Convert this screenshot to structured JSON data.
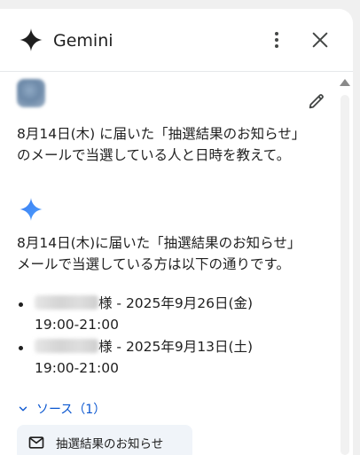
{
  "header": {
    "title": "Gemini",
    "logo_icon": "gemini-sparkle-icon",
    "more_icon": "more-vert-icon",
    "close_icon": "close-icon"
  },
  "prompt": {
    "text_line1": "8月14日(木) に届いた「抽選結果のお知らせ」",
    "text_line2": "のメールで当選している人と日時を教えて。",
    "edit_icon": "pencil-icon"
  },
  "response": {
    "line1": "8月14日(木)に届いた「抽選結果のお知らせ」",
    "line2": "メールで当選している方は以下の通りです。",
    "items": [
      {
        "suffix": "様 - 2025年9月26日(金)",
        "time": "19:00-21:00"
      },
      {
        "suffix": "様 - 2025年9月13日(土)",
        "time": "19:00-21:00"
      }
    ]
  },
  "sources": {
    "label": "ソース（1）",
    "chip_label": "抽選結果のお知らせ",
    "chip_icon": "mail-icon"
  },
  "colors": {
    "accent_blue": "#0b57d0",
    "gemini_blue": "#4285f4",
    "text": "#1f1f1f"
  }
}
